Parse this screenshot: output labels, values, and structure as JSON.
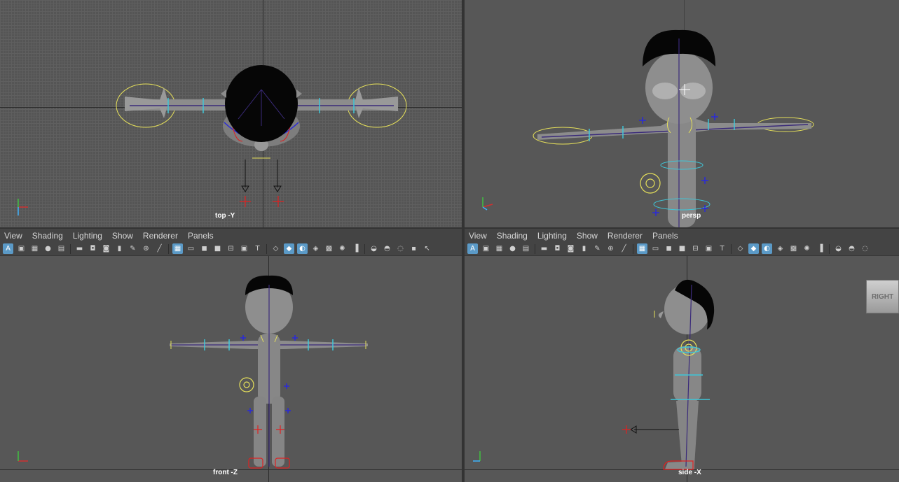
{
  "viewports": {
    "top": {
      "camera_label": "top -Y"
    },
    "persp": {
      "camera_label": "persp"
    },
    "front": {
      "camera_label": "front -Z"
    },
    "side": {
      "camera_label": "side -X"
    }
  },
  "panel_menu": [
    "View",
    "Shading",
    "Lighting",
    "Show",
    "Renderer",
    "Panels"
  ],
  "viewcube": {
    "label": "RIGHT"
  },
  "axis_labels": {
    "x": "x",
    "y": "y",
    "z": "z"
  },
  "toolbar_icons": [
    "select-camera-icon",
    "lock-camera-icon",
    "camera-attributes-icon",
    "bookmarks-icon",
    "image-plane-icon",
    "film-gate-icon",
    "resolution-gate-icon",
    "gate-mask-icon",
    "field-chart-icon",
    "safe-action-icon",
    "grid-icon",
    "wireframe-icon",
    "smooth-shade-icon",
    "default-material-icon",
    "textured-icon",
    "lights-icon",
    "shadows-icon",
    "ambient-occlusion-icon",
    "motion-blur-icon",
    "isolate-select-icon"
  ],
  "colors": {
    "viewport_bg": "#575757",
    "toolbar_bg": "#444444",
    "active_button": "#5b9ac7",
    "control_yellow": "#e6e05a",
    "control_cyan": "#3fc6d8",
    "joint_blue": "#2a2ad8",
    "ik_red": "#e02020",
    "skeleton_purple": "#3a2a7a",
    "model_grey": "#8c8c8c"
  }
}
